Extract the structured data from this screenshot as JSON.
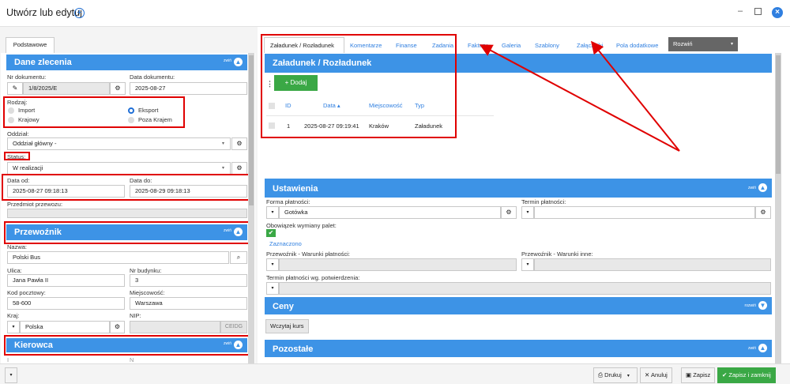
{
  "window": {
    "title": "Utwórz lub edytuj",
    "minimize": "–"
  },
  "left_tab": "Podstawowe",
  "collapse_word": "zwiń",
  "dane_zlecenia": {
    "title": "Dane zlecenia",
    "nr_dokumentu_label": "Nr dokumentu:",
    "nr_dokumentu_value": "1/8/2025/E",
    "data_dokumentu_label": "Data dokumentu:",
    "data_dokumentu_value": "2025-08-27",
    "rodzaj_label": "Rodzaj:",
    "rodzaj_options": [
      "Import",
      "Krajowy",
      "Eksport",
      "Poza Krajem"
    ],
    "rodzaj_selected": "Eksport",
    "oddzial_label": "Oddział:",
    "oddzial_value": "Oddział główny -",
    "status_label": "Status:",
    "status_value": "W realizacji",
    "data_od_label": "Data od:",
    "data_od_value": "2025-08-27 09:18:13",
    "data_do_label": "Data do:",
    "data_do_value": "2025-08-29 09:18:13",
    "przedmiot_label": "Przedmiot przewozu:"
  },
  "przewoznik": {
    "title": "Przewoźnik",
    "nazwa_label": "Nazwa:",
    "nazwa_value": "Polski Bus",
    "ulica_label": "Ulica:",
    "ulica_value": "Jana Pawła II",
    "nr_budynku_label": "Nr budynku:",
    "nr_budynku_value": "3",
    "kod_label": "Kod pocztowy:",
    "kod_value": "58-600",
    "miejscowosc_label": "Miejscowość:",
    "miejscowosc_value": "Warszawa",
    "kraj_label": "Kraj:",
    "kraj_value": "Polska",
    "nip_label": "NIP:",
    "ceidg_label": "CEIDG"
  },
  "kierowca": {
    "title": "Kierowca"
  },
  "right_tabs": [
    "Załadunek / Rozładunek",
    "Komentarze",
    "Finanse",
    "Zadania",
    "Faktury",
    "Galeria",
    "Szablony",
    "Załączniki",
    "Pola dodatkowe"
  ],
  "rozwin": "Rozwiń",
  "zaladunek": {
    "title": "Załadunek / Rozładunek",
    "add_label": "+ Dodaj",
    "columns": [
      "ID",
      "Data ▴",
      "Miejscowość",
      "Typ"
    ],
    "rows": [
      {
        "id": "1",
        "data": "2025-08-27 09:19:41",
        "miejscowosc": "Kraków",
        "typ": "Załadunek"
      }
    ]
  },
  "ustawienia": {
    "title": "Ustawienia",
    "forma_label": "Forma płatności:",
    "forma_value": "Gotówka",
    "termin_label": "Termin płatności:",
    "obowiazek_label": "Obowiązek wymiany palet:",
    "zaznaczono": "Zaznaczono",
    "warunki_platnosci_label": "Przewoźnik - Warunki płatności:",
    "warunki_inne_label": "Przewoźnik - Warunki inne:",
    "termin_potw_label": "Termin płatności wg. potwierdzenia:"
  },
  "ceny": {
    "title": "Ceny",
    "expand_word": "rozwiń"
  },
  "wczytaj_kurs": "Wczytaj kurs",
  "pozostale": {
    "title": "Pozostałe"
  },
  "bottom": {
    "drukuj": "Drukuj",
    "anuluj": "Anuluj",
    "zapisz": "Zapisz",
    "zapisz_zamknij": "Zapisz i zamknij"
  },
  "colors": {
    "accent": "#3d93e6",
    "annotation": "#e00000",
    "success": "#3aa845"
  }
}
